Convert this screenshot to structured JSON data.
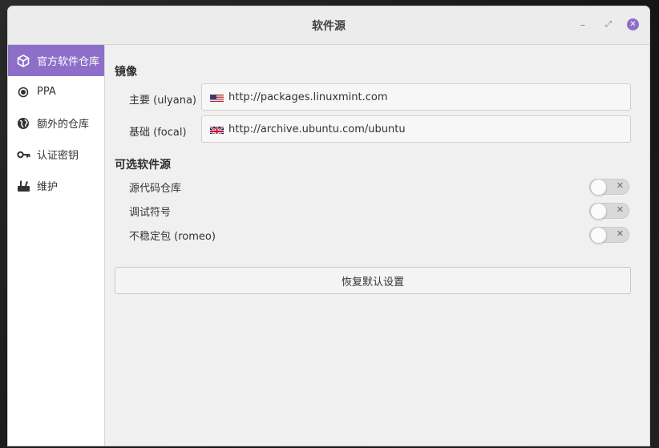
{
  "window": {
    "title": "软件源",
    "controls": {
      "minimize": "–",
      "maximize": "⤢",
      "close": "✕"
    }
  },
  "sidebar": {
    "items": [
      {
        "label": "官方软件仓库",
        "icon": "package-icon",
        "active": true
      },
      {
        "label": "PPA",
        "icon": "ppa-radio-icon",
        "active": false
      },
      {
        "label": "额外的仓库",
        "icon": "globe-icon",
        "active": false
      },
      {
        "label": "认证密钥",
        "icon": "key-icon",
        "active": false
      },
      {
        "label": "维护",
        "icon": "tools-icon",
        "active": false
      }
    ]
  },
  "mirrors": {
    "title": "镜像",
    "main": {
      "label": "主要 (ulyana)",
      "url": "http://packages.linuxmint.com",
      "flag": "us-flag-icon"
    },
    "base": {
      "label": "基础 (focal)",
      "url": "http://archive.ubuntu.com/ubuntu",
      "flag": "uk-flag-icon"
    }
  },
  "optional": {
    "title": "可选软件源",
    "items": [
      {
        "label": "源代码仓库",
        "enabled": false
      },
      {
        "label": "调试符号",
        "enabled": false
      },
      {
        "label": "不稳定包 (romeo)",
        "enabled": false
      }
    ],
    "toggle_off_mark": "✕"
  },
  "restore_button": "恢复默认设置",
  "colors": {
    "accent": "#8d6fc9",
    "close_button": "#8c6fcb"
  }
}
